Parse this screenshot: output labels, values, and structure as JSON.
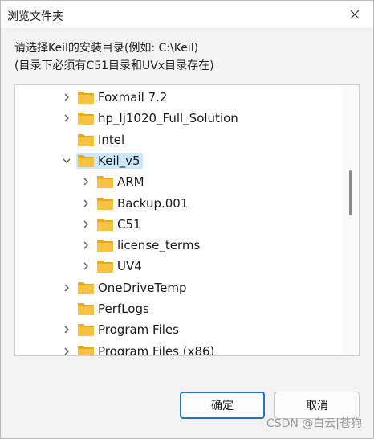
{
  "window": {
    "title": "浏览文件夹"
  },
  "instructions": {
    "line1": "请选择Keil的安装目录(例如: C:\\Keil)",
    "line2": "(目录下必须有C51目录和UVx目录存在)"
  },
  "tree": {
    "items": [
      {
        "label": "Foxmail 7.2",
        "level": 0,
        "expander": "collapsed",
        "selected": false
      },
      {
        "label": "hp_lj1020_Full_Solution",
        "level": 0,
        "expander": "collapsed",
        "selected": false
      },
      {
        "label": "Intel",
        "level": 0,
        "expander": "none",
        "selected": false
      },
      {
        "label": "Keil_v5",
        "level": 0,
        "expander": "expanded",
        "selected": true
      },
      {
        "label": "ARM",
        "level": 1,
        "expander": "collapsed",
        "selected": false
      },
      {
        "label": "Backup.001",
        "level": 1,
        "expander": "collapsed",
        "selected": false
      },
      {
        "label": "C51",
        "level": 1,
        "expander": "collapsed",
        "selected": false
      },
      {
        "label": "license_terms",
        "level": 1,
        "expander": "collapsed",
        "selected": false
      },
      {
        "label": "UV4",
        "level": 1,
        "expander": "collapsed",
        "selected": false
      },
      {
        "label": "OneDriveTemp",
        "level": 0,
        "expander": "collapsed",
        "selected": false
      },
      {
        "label": "PerfLogs",
        "level": 0,
        "expander": "none",
        "selected": false
      },
      {
        "label": "Program Files",
        "level": 0,
        "expander": "collapsed",
        "selected": false
      },
      {
        "label": "Program Files (x86)",
        "level": 0,
        "expander": "collapsed",
        "selected": false
      }
    ]
  },
  "buttons": {
    "ok_label": "确定",
    "cancel_label": "取消"
  },
  "watermark": {
    "text": "CSDN @白云|苍狗"
  },
  "colors": {
    "folder": "#f5c242",
    "folder_dark": "#e4a920",
    "selection": "#cce8ff",
    "accent": "#2b6fc8"
  }
}
